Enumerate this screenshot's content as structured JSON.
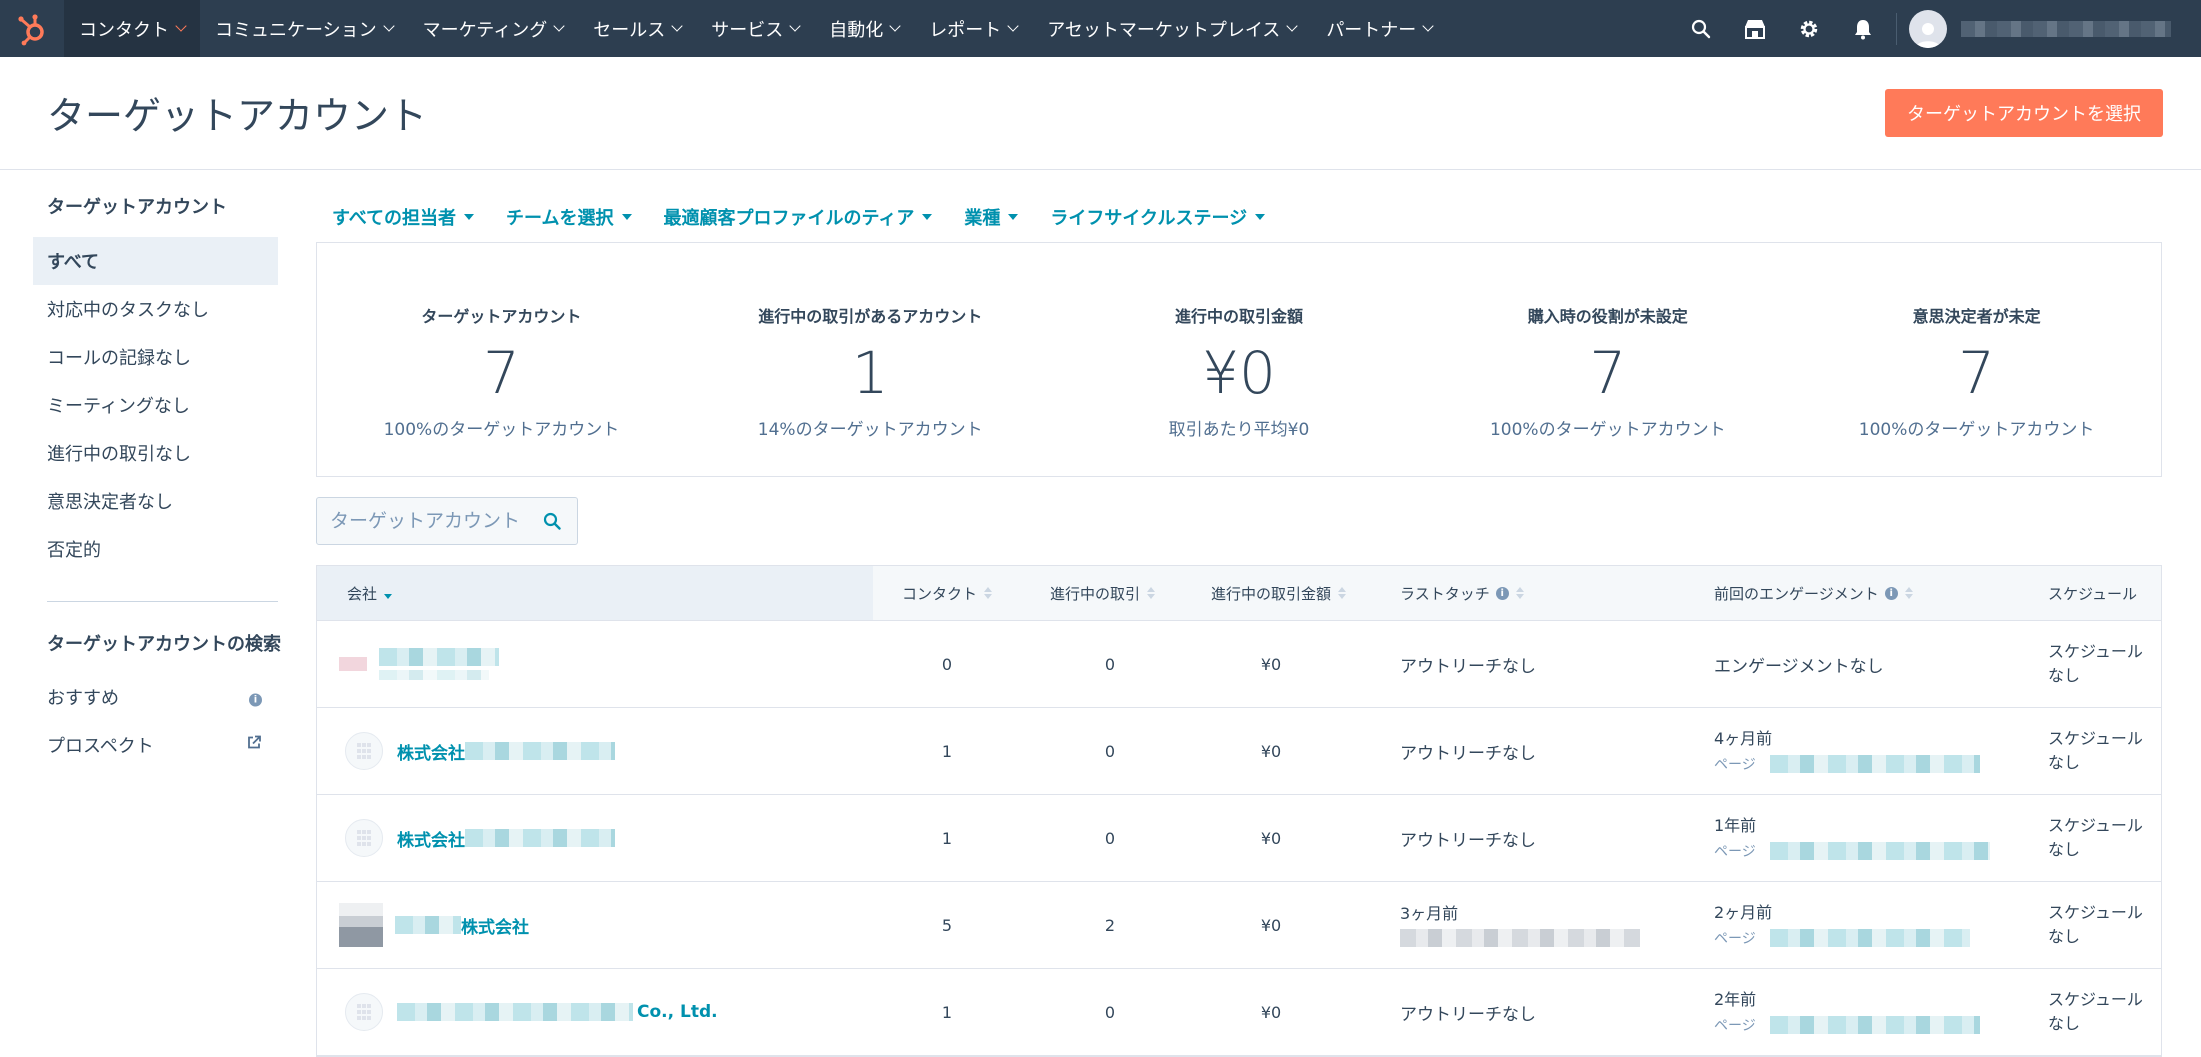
{
  "nav": {
    "items": [
      {
        "label": "コンタクト",
        "active": true
      },
      {
        "label": "コミュニケーション"
      },
      {
        "label": "マーケティング"
      },
      {
        "label": "セールス"
      },
      {
        "label": "サービス"
      },
      {
        "label": "自動化"
      },
      {
        "label": "レポート"
      },
      {
        "label": "アセットマーケットプレイス"
      },
      {
        "label": "パートナー"
      }
    ],
    "brand_color": "#ff7a59",
    "bg_color": "#2d3e50"
  },
  "header": {
    "title": "ターゲットアカウント",
    "primary_button": "ターゲットアカウントを選択"
  },
  "sidebar": {
    "heading": "ターゲットアカウント",
    "items": [
      {
        "label": "すべて",
        "selected": true
      },
      {
        "label": "対応中のタスクなし"
      },
      {
        "label": "コールの記録なし"
      },
      {
        "label": "ミーティングなし"
      },
      {
        "label": "進行中の取引なし"
      },
      {
        "label": "意思決定者なし"
      },
      {
        "label": "否定的"
      }
    ],
    "search_heading": "ターゲットアカウントの検索",
    "search_items": [
      {
        "label": "おすすめ",
        "icon": "info-icon"
      },
      {
        "label": "プロスペクト",
        "icon": "external-link-icon"
      }
    ]
  },
  "filters": [
    "すべての担当者",
    "チームを選択",
    "最適顧客プロファイルのティア",
    "業種",
    "ライフサイクルステージ"
  ],
  "stats": [
    {
      "label": "ターゲットアカウント",
      "value": "7",
      "sub": "100%のターゲットアカウント"
    },
    {
      "label": "進行中の取引があるアカウント",
      "value": "1",
      "sub": "14%のターゲットアカウント"
    },
    {
      "label": "進行中の取引金額",
      "value": "¥0",
      "sub": "取引あたり平均¥0"
    },
    {
      "label": "購入時の役割が未設定",
      "value": "7",
      "sub": "100%のターゲットアカウント"
    },
    {
      "label": "意思決定者が未定",
      "value": "7",
      "sub": "100%のターゲットアカウント"
    }
  ],
  "search": {
    "placeholder": "ターゲットアカウント"
  },
  "table": {
    "columns": [
      "会社",
      "コンタクト",
      "進行中の取引",
      "進行中の取引金額",
      "ラストタッチ",
      "前回のエンゲージメント",
      "スケジュール"
    ],
    "rows": [
      {
        "company": "",
        "contacts": "0",
        "deals": "0",
        "amount": "¥0",
        "last_touch": "アウトリーチなし",
        "last_touch_sub": "",
        "engagement": "エンゲージメントなし",
        "engagement_sub": "",
        "schedule": "スケジュールなし"
      },
      {
        "company": "株式会社",
        "contacts": "1",
        "deals": "0",
        "amount": "¥0",
        "last_touch": "アウトリーチなし",
        "last_touch_sub": "",
        "engagement": "4ヶ月前",
        "engagement_sub": "ページ",
        "schedule": "スケジュールなし"
      },
      {
        "company": "株式会社",
        "contacts": "1",
        "deals": "0",
        "amount": "¥0",
        "last_touch": "アウトリーチなし",
        "last_touch_sub": "",
        "engagement": "1年前",
        "engagement_sub": "ページ",
        "schedule": "スケジュールなし"
      },
      {
        "company": "株式会社",
        "contacts": "5",
        "deals": "2",
        "amount": "¥0",
        "last_touch": "3ヶ月前",
        "last_touch_sub": "",
        "engagement": "2ヶ月前",
        "engagement_sub": "ページ",
        "schedule": "スケジュールなし"
      },
      {
        "company": "Co., Ltd.",
        "contacts": "1",
        "deals": "0",
        "amount": "¥0",
        "last_touch": "アウトリーチなし",
        "last_touch_sub": "",
        "engagement": "2年前",
        "engagement_sub": "ページ",
        "schedule": "スケジュールなし"
      }
    ]
  }
}
